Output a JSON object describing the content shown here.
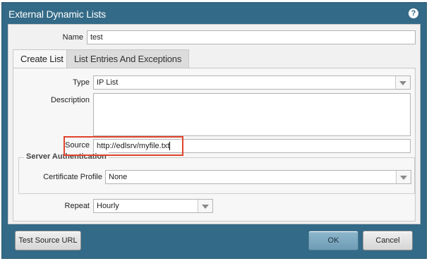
{
  "window": {
    "title": "External Dynamic Lists",
    "help_glyph": "?"
  },
  "name": {
    "label": "Name",
    "value": "test"
  },
  "tabs": [
    {
      "label": "Create List",
      "active": true
    },
    {
      "label": "List Entries And Exceptions",
      "active": false
    }
  ],
  "create_list": {
    "type": {
      "label": "Type",
      "value": "IP List"
    },
    "description": {
      "label": "Description",
      "value": ""
    },
    "source": {
      "label": "Source",
      "value": "http://edlsrv/myfile.txt"
    },
    "server_auth": {
      "legend": "Server Authentication",
      "certificate_profile": {
        "label": "Certificate Profile",
        "value": "None"
      }
    },
    "repeat": {
      "label": "Repeat",
      "value": "Hourly"
    }
  },
  "footer": {
    "test_source_url_label": "Test Source URL",
    "ok_label": "OK",
    "cancel_label": "Cancel"
  },
  "colors": {
    "dialog_frame": "#336a87",
    "highlight_box": "#e0442e",
    "ok_button": "#7ea9c1"
  }
}
